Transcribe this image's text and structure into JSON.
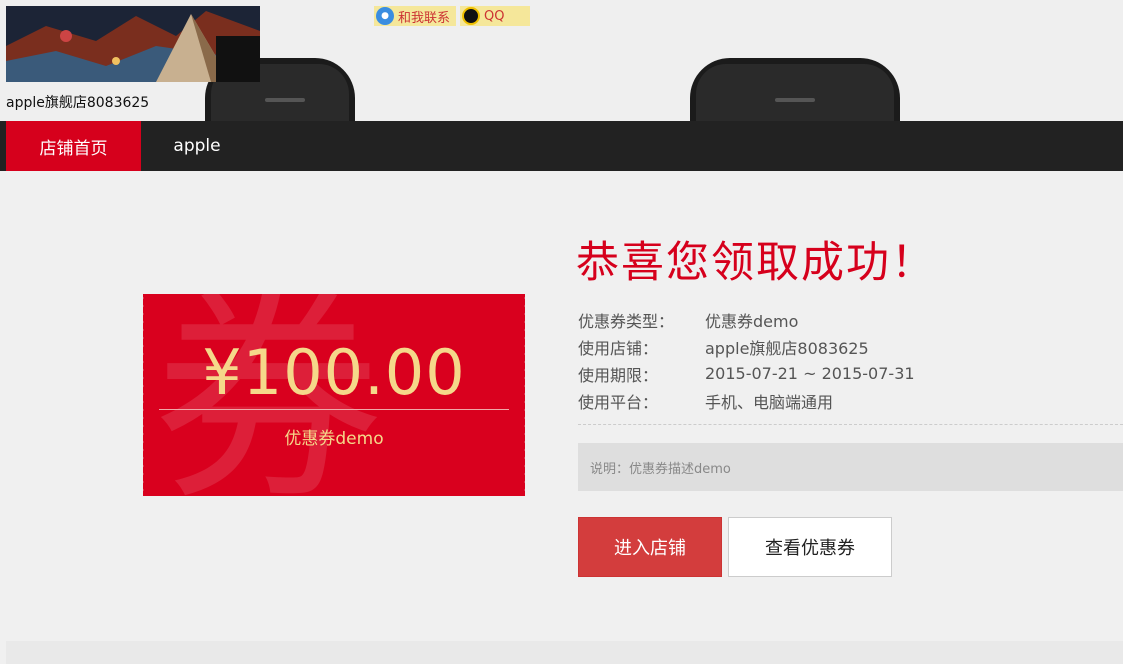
{
  "header": {
    "shop_name": "apple旗舰店8083625",
    "contact_label": "和我联系",
    "qq_label": "QQ"
  },
  "nav": {
    "items": [
      {
        "label": "店铺首页",
        "active": true
      },
      {
        "label": "apple",
        "active": false
      }
    ]
  },
  "coupon": {
    "amount": "¥100.00",
    "name": "优惠券demo",
    "watermark": "券",
    "color": "#d9001e"
  },
  "result": {
    "title": "恭喜您领取成功！",
    "fields": [
      {
        "label": "优惠券类型：",
        "value": "优惠券demo"
      },
      {
        "label": "使用店铺：",
        "value": "apple旗舰店8083625"
      },
      {
        "label": "使用期限：",
        "value": "2015-07-21 ~ 2015-07-31"
      },
      {
        "label": "使用平台：",
        "value": "手机、电脑端通用"
      }
    ],
    "note": "说明：优惠券描述demo"
  },
  "buttons": {
    "enter_shop": "进入店铺",
    "view_coupons": "查看优惠券"
  },
  "colors": {
    "accent": "#d6001c",
    "nav_bg": "#222222",
    "coupon_text": "#f5d88a"
  }
}
